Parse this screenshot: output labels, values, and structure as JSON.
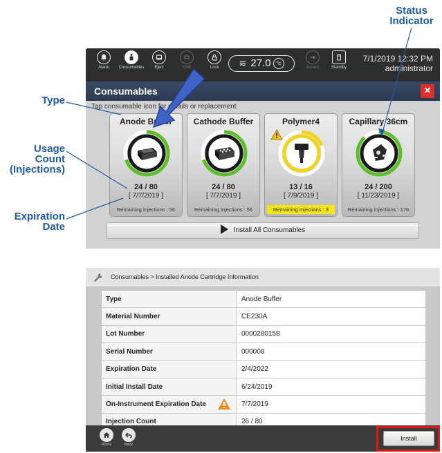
{
  "annotations": {
    "status_indicator": [
      "Status",
      "Indicator"
    ],
    "type": "Type",
    "usage_count": [
      "Usage Count",
      "(Injections)"
    ],
    "expiration_date": [
      "Expiration",
      "Date"
    ]
  },
  "topbar": {
    "items": [
      {
        "label": "Alarm",
        "icon": "bell-icon"
      },
      {
        "label": "Consumables",
        "icon": "consumables-icon",
        "active": true
      },
      {
        "label": "Eject",
        "icon": "eject-icon"
      },
      {
        "label": "USB",
        "icon": "usb-icon",
        "disabled": true
      },
      {
        "label": "Lock",
        "icon": "lock-icon"
      }
    ],
    "temperature": "27.0",
    "temperature_unit": "°c",
    "access_label": "Access",
    "standby_label": "Standby",
    "datetime": "7/1/2019 12:32 PM",
    "user": "administrator"
  },
  "consumables_panel": {
    "title": "Consumables",
    "close_label": "×",
    "hint": "Tap consumable icon for details or replacement",
    "cards": [
      {
        "name": "Anode Buffer",
        "count": "24 / 80",
        "date": "[ 7/7/2019 ]",
        "remaining": "Remaining Injections : 56",
        "fraction": 0.7,
        "status_color": "#5cbf2a",
        "warning": false
      },
      {
        "name": "Cathode Buffer",
        "count": "24 / 80",
        "date": "[ 7/7/2019 ]",
        "remaining": "Remaining Injections : 56",
        "fraction": 0.7,
        "status_color": "#5cbf2a",
        "warning": false
      },
      {
        "name": "Polymer4",
        "count": "13 / 16",
        "date": "[ 7/9/2019 ]",
        "remaining": "Remaining Injections : 3",
        "fraction": 0.19,
        "status_color": "#f2d21b",
        "warning": true
      },
      {
        "name": "Capillary 36cm",
        "count": "24 / 200",
        "date": "[ 11/23/2019 ]",
        "remaining": "Remaining Injections : 176",
        "fraction": 0.88,
        "status_color": "#5cbf2a",
        "warning": false
      }
    ],
    "install_all_label": "Install All Consumables"
  },
  "cartridge_info": {
    "breadcrumb": "Consumables > Installed Anode Cartridge Information",
    "rows": [
      {
        "key": "Type",
        "value": "Anode Buffer"
      },
      {
        "key": "Material Number",
        "value": "CE230A"
      },
      {
        "key": "Lot Number",
        "value": "0000280158"
      },
      {
        "key": "Serial Number",
        "value": "000008"
      },
      {
        "key": "Expiration Date",
        "value": "2/4/2022"
      },
      {
        "key": "Initial Install Date",
        "value": "6/24/2019"
      },
      {
        "key": "On-Instrument Expiration Date",
        "value": "7/7/2019",
        "warning": true
      },
      {
        "key": "Injection Count",
        "value": "26 / 80"
      }
    ],
    "home_label": "Home",
    "back_label": "Back",
    "install_label": "Install"
  },
  "colors": {
    "callout": "#1e5aa8",
    "highlight": "#e01818",
    "ok": "#5cbf2a",
    "warn": "#f2d21b"
  }
}
